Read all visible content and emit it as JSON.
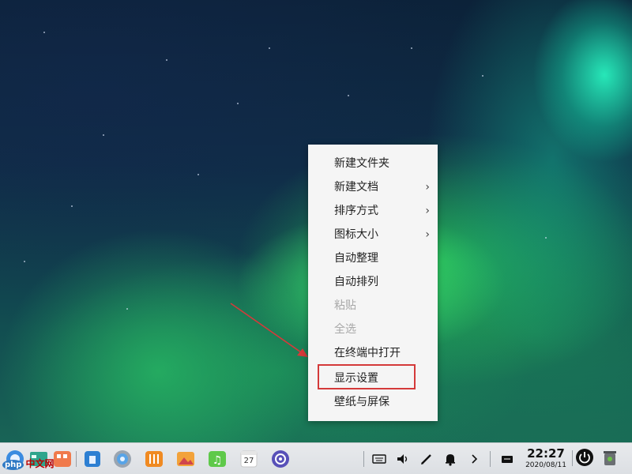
{
  "context_menu": {
    "items": [
      {
        "label": "新建文件夹",
        "submenu": false,
        "disabled": false
      },
      {
        "label": "新建文档",
        "submenu": true,
        "disabled": false
      },
      {
        "label": "排序方式",
        "submenu": true,
        "disabled": false
      },
      {
        "label": "图标大小",
        "submenu": true,
        "disabled": false
      },
      {
        "label": "自动整理",
        "submenu": false,
        "disabled": false
      },
      {
        "label": "自动排列",
        "submenu": false,
        "disabled": false
      },
      {
        "label": "粘贴",
        "submenu": false,
        "disabled": true
      },
      {
        "label": "全选",
        "submenu": false,
        "disabled": true
      },
      {
        "label": "在终端中打开",
        "submenu": false,
        "disabled": false
      },
      {
        "label": "显示设置",
        "submenu": false,
        "disabled": false,
        "highlighted": true
      },
      {
        "label": "壁纸与屏保",
        "submenu": false,
        "disabled": false
      }
    ],
    "submenu_glyph": "›"
  },
  "taskbar": {
    "calendar_day": "27",
    "clock": {
      "time": "22:27",
      "date": "2020/08/11"
    },
    "tray_icons": [
      "keyboard-icon",
      "volume-icon",
      "pen-icon",
      "bell-icon",
      "chevron-right-icon",
      "input-method-icon"
    ]
  },
  "watermark": {
    "badge": "php",
    "text": "中文网"
  },
  "colors": {
    "highlight_box": "#d43a3a",
    "annotation_arrow": "#d43a3a",
    "menu_background": "#f5f5f5",
    "disabled_text": "#a8a8a8"
  }
}
